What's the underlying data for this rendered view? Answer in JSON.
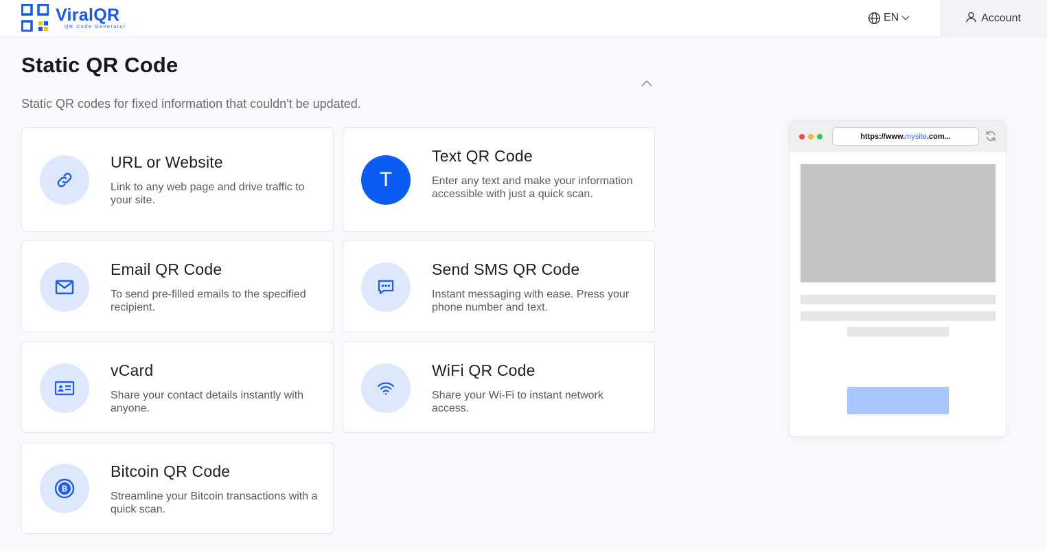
{
  "header": {
    "logo_name": "ViralQR",
    "logo_sub": "QR Code Generator",
    "language": "EN",
    "account_label": "Account"
  },
  "page": {
    "title": "Static QR Code",
    "subtitle": "Static QR codes for fixed information that couldn't be updated."
  },
  "cards": [
    {
      "title": "URL or Website",
      "desc": "Link to any web page and drive traffic to your site.",
      "icon": "link-icon"
    },
    {
      "title": "Text QR Code",
      "desc": "Enter any text and make your information accessible with just a quick scan.",
      "icon": "T"
    },
    {
      "title": "Email QR Code",
      "desc": "To send pre-filled emails to the specified recipient.",
      "icon": "mail-icon"
    },
    {
      "title": "Send SMS QR Code",
      "desc": "Instant messaging with ease. Press your phone number and text.",
      "icon": "chat-icon"
    },
    {
      "title": "vCard",
      "desc": "Share your contact details instantly with anyone.",
      "icon": "contact-card-icon"
    },
    {
      "title": "WiFi QR Code",
      "desc": "Share your Wi-Fi to instant network access.",
      "icon": "wifi-icon"
    },
    {
      "title": "Bitcoin QR Code",
      "desc": "Streamline your Bitcoin transactions with a quick scan.",
      "icon": "bitcoin-icon"
    }
  ],
  "preview": {
    "url_prefix": "https://www.",
    "url_highlight": "mysite",
    "url_suffix": ".com..."
  },
  "colors": {
    "brand": "#1557f0",
    "icon_bg": "#dde8fd",
    "icon_fg": "#1f5ce8",
    "active_icon": "#0a5cf5",
    "preview_button": "#a9c7ff"
  }
}
